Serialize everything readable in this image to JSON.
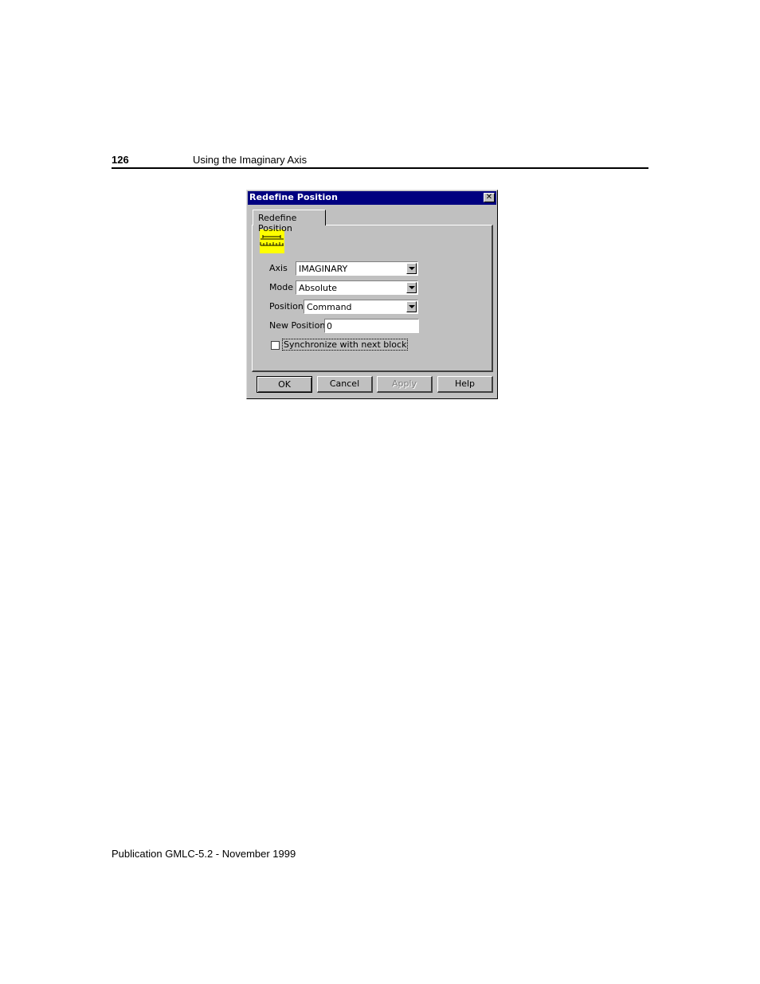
{
  "page": {
    "number": "126",
    "header_title": "Using the Imaginary Axis",
    "footer": "Publication GMLC-5.2 - November 1999"
  },
  "dialog": {
    "title": "Redefine Position",
    "close_glyph": "✕",
    "tab_label": "Redefine Position",
    "icon": "ruler-icon",
    "fields": {
      "axis": {
        "label": "Axis",
        "value": "IMAGINARY"
      },
      "mode": {
        "label": "Mode",
        "value": "Absolute"
      },
      "position": {
        "label": "Position",
        "value": "Command"
      },
      "new_position": {
        "label": "New Position",
        "value": "0"
      }
    },
    "checkbox": {
      "label": "Synchronize with next block",
      "checked": false
    },
    "buttons": {
      "ok": "OK",
      "cancel": "Cancel",
      "apply": "Apply",
      "help": "Help"
    }
  }
}
